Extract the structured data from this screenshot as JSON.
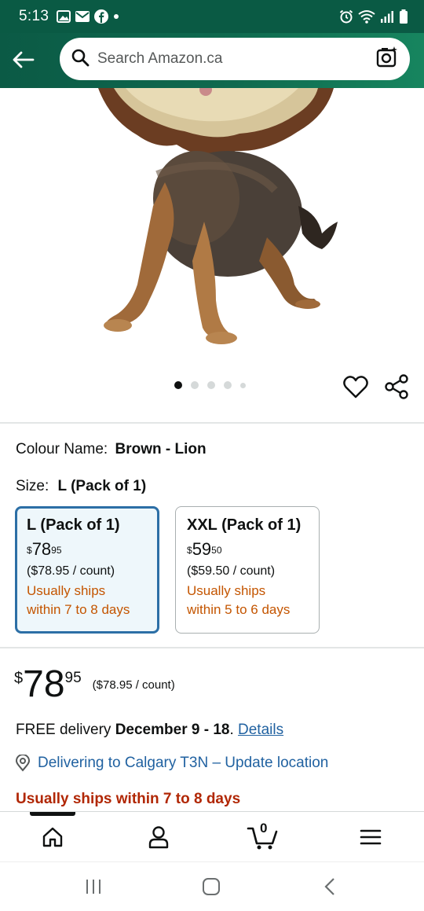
{
  "status_bar": {
    "time": "5:13",
    "left_icons": [
      "gallery-icon",
      "mail-icon",
      "facebook-icon",
      "dot-icon"
    ],
    "right_icons": [
      "alarm-icon",
      "wifi-icon",
      "signal-icon",
      "battery-icon"
    ]
  },
  "header": {
    "search_placeholder": "Search Amazon.ca",
    "back_icon": "arrow-left-icon",
    "camera_icon": "camera-search-icon",
    "bg_color": "#0b5a45"
  },
  "gallery": {
    "dots_total": 5,
    "active_index": 0
  },
  "product": {
    "colour_label": "Colour Name:",
    "colour_value": "Brown - Lion",
    "size_label": "Size:",
    "size_value": "L (Pack of 1)",
    "sizes": [
      {
        "name": "L (Pack of 1)",
        "cur": "$",
        "whole": "78",
        "frac": "95",
        "unit_price": "($78.95 / count)",
        "ship_line1": "Usually ships",
        "ship_line2": "within 7 to 8 days",
        "selected": true
      },
      {
        "name": "XXL (Pack of 1)",
        "cur": "$",
        "whole": "59",
        "frac": "50",
        "unit_price": "($59.50 / count)",
        "ship_line1": "Usually ships",
        "ship_line2": "within 5 to 6 days",
        "selected": false
      }
    ],
    "price": {
      "cur": "$",
      "whole": "78",
      "frac": "95",
      "unit": "($78.95 / count)"
    },
    "delivery": {
      "prefix": "FREE delivery ",
      "dates": "December 9 - 18",
      "suffix": ". ",
      "details_link": "Details"
    },
    "deliver_to": "Delivering to Calgary T3N – Update location",
    "ships_notice": "Usually ships within 7 to 8 days"
  },
  "bottom_nav": {
    "items": [
      "home-icon",
      "account-icon",
      "cart-icon",
      "menu-icon"
    ],
    "cart_count": "0"
  },
  "accent_colors": {
    "link": "#2162a1",
    "ship_orange": "#c45500",
    "ship_red": "#b12704",
    "selected_border": "#2c6fa6"
  }
}
